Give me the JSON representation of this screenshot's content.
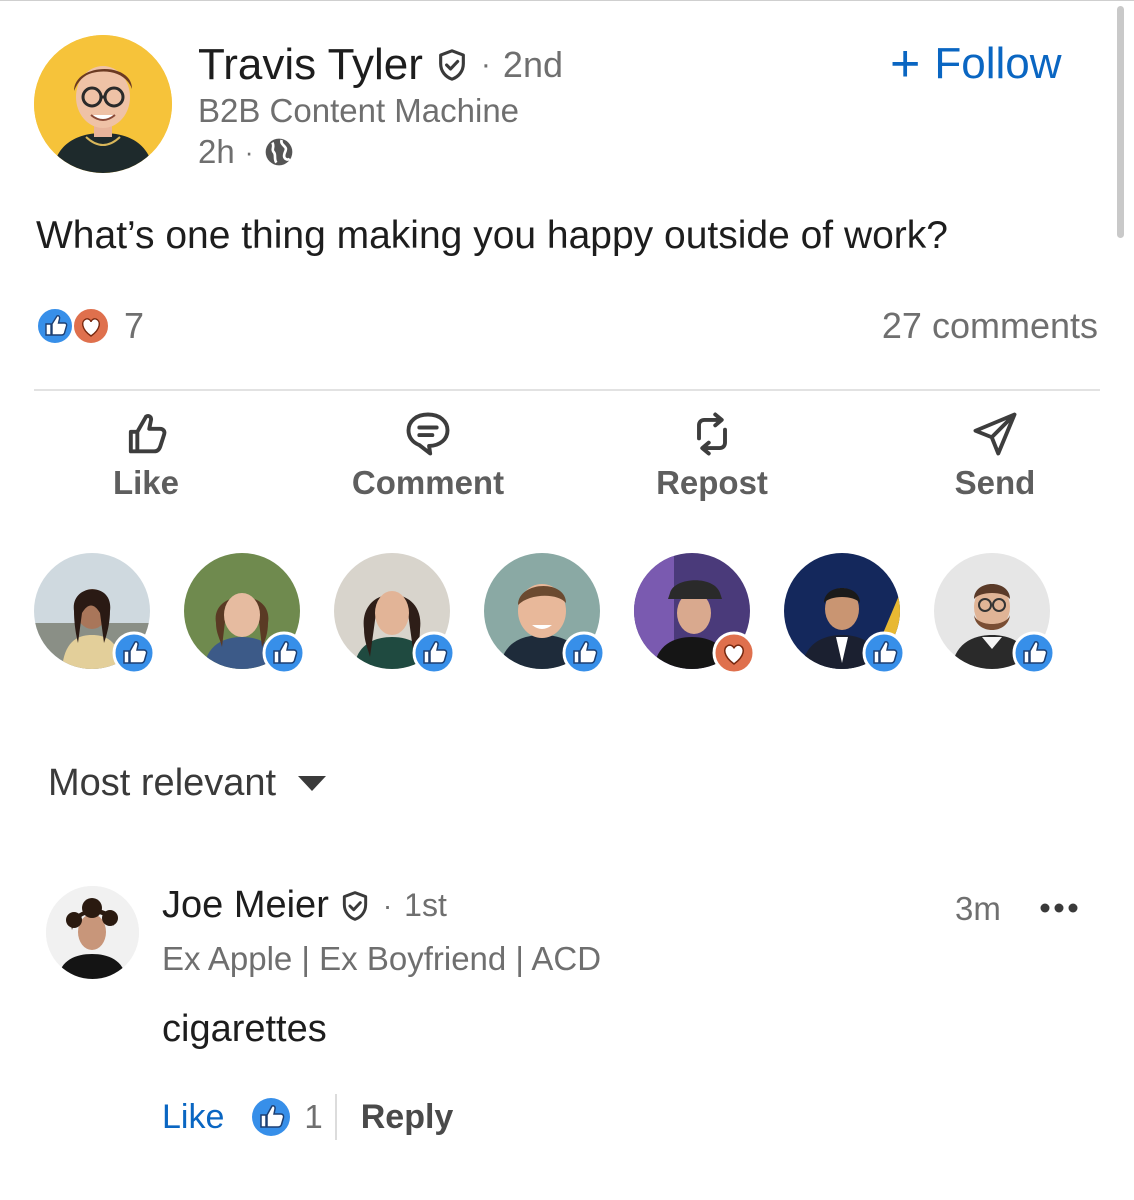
{
  "post": {
    "author": {
      "name": "Travis Tyler",
      "verified_icon": "shield-check-icon",
      "separator": "·",
      "degree": "2nd",
      "headline": "B2B Content Machine",
      "time": "2h",
      "visibility_icon": "globe-icon"
    },
    "follow_label": "Follow",
    "text": "What’s one thing making you happy outside of work?",
    "reaction_count": "7",
    "reaction_icons": [
      "like-reaction-icon",
      "love-reaction-icon"
    ],
    "comments_count": "27 comments"
  },
  "actions": [
    {
      "label": "Like",
      "icon": "thumbs-up-outline-icon"
    },
    {
      "label": "Comment",
      "icon": "comment-bubble-icon"
    },
    {
      "label": "Repost",
      "icon": "repost-arrows-icon"
    },
    {
      "label": "Send",
      "icon": "paper-plane-icon"
    }
  ],
  "reactors": [
    {
      "reaction": "like"
    },
    {
      "reaction": "like"
    },
    {
      "reaction": "like"
    },
    {
      "reaction": "like"
    },
    {
      "reaction": "love"
    },
    {
      "reaction": "like"
    },
    {
      "reaction": "like"
    }
  ],
  "sort": {
    "label": "Most relevant"
  },
  "comment": {
    "name": "Joe Meier",
    "separator": "·",
    "degree": "1st",
    "headline": "Ex Apple | Ex Boyfriend | ACD",
    "time": "3m",
    "text": "cigarettes",
    "like_label": "Like",
    "like_count": "1",
    "reply_label": "Reply"
  },
  "colors": {
    "accent": "#0a66c2",
    "like_badge": "#378fe9",
    "love_badge": "#df704d",
    "author_avatar_bg": "#f6c33a"
  }
}
